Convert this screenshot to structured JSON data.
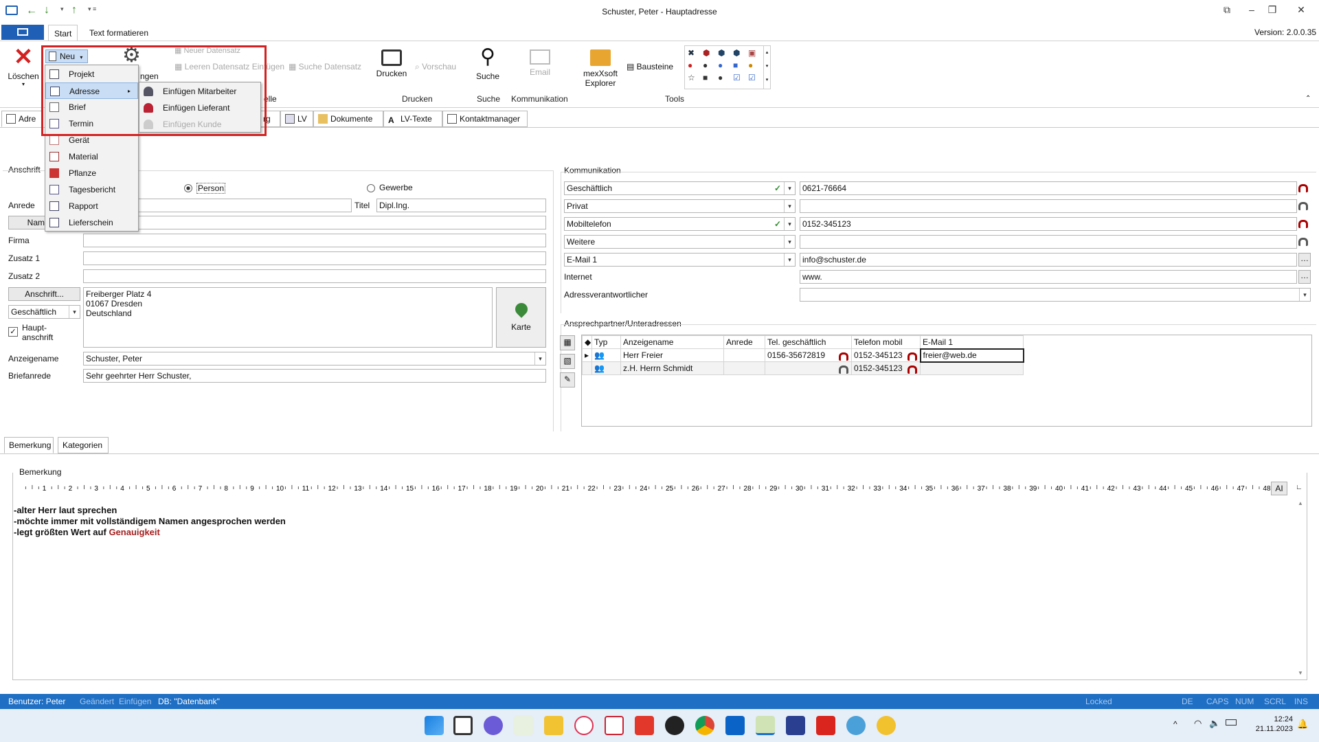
{
  "window": {
    "title": "Schuster, Peter - Hauptadresse",
    "version": "Version: 2.0.0.35"
  },
  "ribbon_tabs": [
    "Start",
    "Text formatieren"
  ],
  "ribbon": {
    "loeschen": "Löschen",
    "neu": "Neu",
    "einstellungen_partial": "ngen",
    "neuer_datensatz": "Neuer Datensatz",
    "leeren_datensatz": "Leeren Datensatz Einfügen",
    "suche_datensatz": "Suche Datensatz",
    "aktuelle_partial": "elle",
    "drucken": "Drucken",
    "vorschau": "Vorschau",
    "suche": "Suche",
    "email": "Email",
    "explorer": "mexXsoft Explorer",
    "bausteine": "Bausteine",
    "groups": {
      "drucken": "Drucken",
      "suche": "Suche",
      "kommunikation": "Kommunikation",
      "tools": "Tools"
    }
  },
  "doc_tabs": [
    "Adre",
    "rg",
    "LV",
    "Dokumente",
    "LV-Texte",
    "Kontaktmanager"
  ],
  "menu_neu": [
    "Projekt",
    "Adresse",
    "Brief",
    "Termin",
    "Gerät",
    "Material",
    "Pflanze",
    "Tagesbericht",
    "Rapport",
    "Lieferschein"
  ],
  "submenu_adresse": [
    "Einfügen Mitarbeiter",
    "Einfügen Lieferant",
    "Einfügen Kunde"
  ],
  "anschrift": {
    "group_label": "Anschrift",
    "person": "Person",
    "gewerbe": "Gewerbe",
    "anrede_label": "Anrede",
    "titel_label": "Titel",
    "titel_value": "Dipl.Ing.",
    "name_btn": "Nam",
    "firma_label": "Firma",
    "zusatz1_label": "Zusatz 1",
    "zusatz2_label": "Zusatz 2",
    "anschrift_btn": "Anschrift...",
    "address_lines": [
      "Freiberger Platz 4",
      "01067 Dresden",
      "Deutschland"
    ],
    "address_type": "Geschäftlich",
    "haupt_label": "Haupt-\nanschrift",
    "karte": "Karte",
    "anzeigename_label": "Anzeigename",
    "anzeigename_value": "Schuster, Peter",
    "briefanrede_label": "Briefanrede",
    "briefanrede_value": "Sehr geehrter Herr Schuster,"
  },
  "kommunikation": {
    "group_label": "Kommunikation",
    "rows": [
      {
        "type": "Geschäftlich",
        "value": "0621-76664",
        "checked": true
      },
      {
        "type": "Privat",
        "value": "",
        "checked": false
      },
      {
        "type": "Mobiltelefon",
        "value": "0152-345123",
        "checked": true
      },
      {
        "type": "Weitere",
        "value": "",
        "checked": false
      },
      {
        "type": "E-Mail 1",
        "value": "info@schuster.de",
        "checked": false
      }
    ],
    "internet_label": "Internet",
    "internet_value": "www.",
    "verantwortlicher_label": "Adressverantwortlicher"
  },
  "ansprechpartner": {
    "group_label": "Ansprechpartner/Unteradressen",
    "columns": [
      "Typ",
      "Anzeigename",
      "Anrede",
      "Tel. geschäftlich",
      "Telefon mobil",
      "E-Mail 1"
    ],
    "rows": [
      {
        "name": "Herr Freier",
        "anrede": "",
        "tel": "0156-35672819",
        "mobil": "0152-345123",
        "email": "freier@web.de"
      },
      {
        "name": "z.H. Herrn Schmidt",
        "anrede": "",
        "tel": "",
        "mobil": "0152-345123",
        "email": ""
      }
    ]
  },
  "lower_tabs": [
    "Bemerkung",
    "Kategorien"
  ],
  "bemerkung": {
    "label": "Bemerkung",
    "ruler_ai": "AI",
    "line1": "-alter Herr laut sprechen",
    "line2": "-möchte immer mit vollständigem Namen angesprochen werden",
    "line3_prefix": "-legt größten Wert auf ",
    "line3_highlight": "Genauigkeit"
  },
  "status": {
    "user": "Benutzer: Peter",
    "geaendert": "Geändert",
    "einfuegen": "Einfügen",
    "db": "DB: \"Datenbank\"",
    "locked": "Locked",
    "de": "DE",
    "caps": "CAPS",
    "num": "NUM",
    "scrl": "SCRL",
    "ins": "INS"
  },
  "clock": {
    "time": "12:24",
    "date": "21.11.2023"
  },
  "colors": {
    "accent": "#1f6fc4",
    "highlight_red": "#d42020",
    "text_red": "#a52020"
  }
}
